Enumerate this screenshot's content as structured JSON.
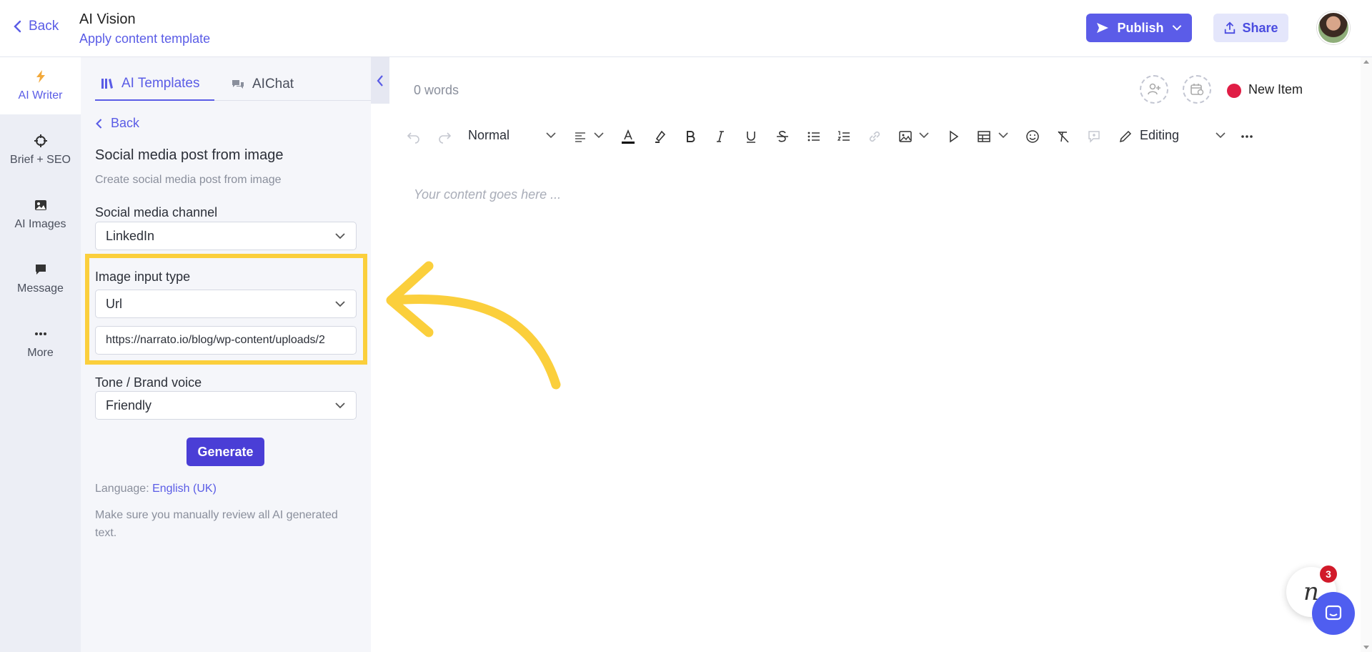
{
  "header": {
    "back_label": "Back",
    "title": "AI Vision",
    "subtitle": "Apply content template",
    "publish_label": "Publish",
    "share_label": "Share",
    "accent_color": "#5b5ce8"
  },
  "rail": {
    "items": [
      {
        "label": "AI Writer",
        "icon": "lightning-icon"
      },
      {
        "label": "Brief + SEO",
        "icon": "crosshair-icon"
      },
      {
        "label": "AI Images",
        "icon": "image-icon"
      },
      {
        "label": "Message",
        "icon": "message-icon"
      },
      {
        "label": "More",
        "icon": "more-icon"
      }
    ]
  },
  "panel": {
    "tabs": [
      {
        "label": "AI Templates",
        "icon": "library-icon",
        "active": true
      },
      {
        "label": "AIChat",
        "icon": "chat-bubbles-icon",
        "active": false
      }
    ],
    "back_label": "Back",
    "template_title": "Social media post from image",
    "template_desc": "Create social media post from image",
    "channel_label": "Social media channel",
    "channel_value": "LinkedIn",
    "image_type_label": "Image input type",
    "image_type_value": "Url",
    "image_url_value": "https://narrato.io/blog/wp-content/uploads/2",
    "tone_label": "Tone / Brand voice",
    "tone_value": "Friendly",
    "generate_label": "Generate",
    "language_prefix": "Language:",
    "language_value": "English (UK)",
    "disclaimer": "Make sure you manually review all AI generated text.",
    "highlight_color": "#fbcf3c"
  },
  "editor": {
    "word_count": "0 words",
    "status_label": "New Item",
    "status_color": "#e01d45",
    "style_select": "Normal",
    "mode_select": "Editing",
    "placeholder": "Your content goes here ..."
  },
  "widgets": {
    "narrato_letter": "n",
    "notification_count": "3"
  }
}
